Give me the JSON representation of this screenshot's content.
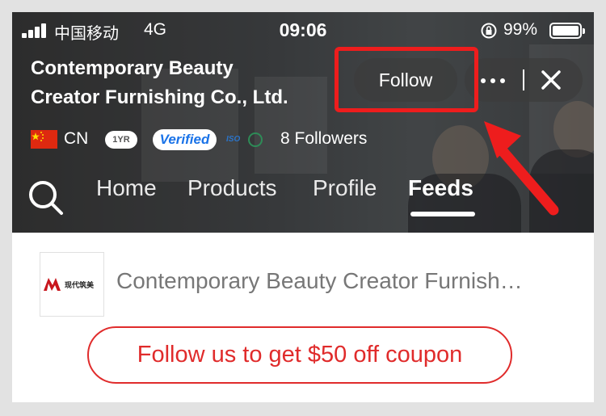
{
  "status_bar": {
    "carrier": "中国移动",
    "network": "4G",
    "time": "09:06",
    "battery": "99%",
    "battery_level": 0.99
  },
  "header": {
    "store_name_line1": "Contemporary Beauty",
    "store_name_line2": "Creator Furnishing Co., Ltd.",
    "follow_label": "Follow",
    "country_code": "CN",
    "years_badge": "1YR",
    "verified_badge": "Verified",
    "iso_badge": "ISO",
    "followers": "8 Followers"
  },
  "tabs": [
    {
      "label": "Home",
      "active": false
    },
    {
      "label": "Products",
      "active": false
    },
    {
      "label": "Profile",
      "active": false
    },
    {
      "label": "Feeds",
      "active": true
    }
  ],
  "content": {
    "logo_text": "现代筑美",
    "company_name": "Contemporary Beauty Creator Furnish…",
    "coupon_button": "Follow us to get $50 off coupon"
  },
  "colors": {
    "annotation_red": "#ee1d1d",
    "coupon_red": "#e02b2b",
    "verified_blue": "#1a73e8",
    "logo_red": "#c8161d"
  },
  "icons": [
    "signal-icon",
    "rotation-lock-icon",
    "battery-icon",
    "more-icon",
    "close-icon",
    "china-flag-icon",
    "iso-icon",
    "search-icon",
    "annotation-arrow-icon"
  ]
}
